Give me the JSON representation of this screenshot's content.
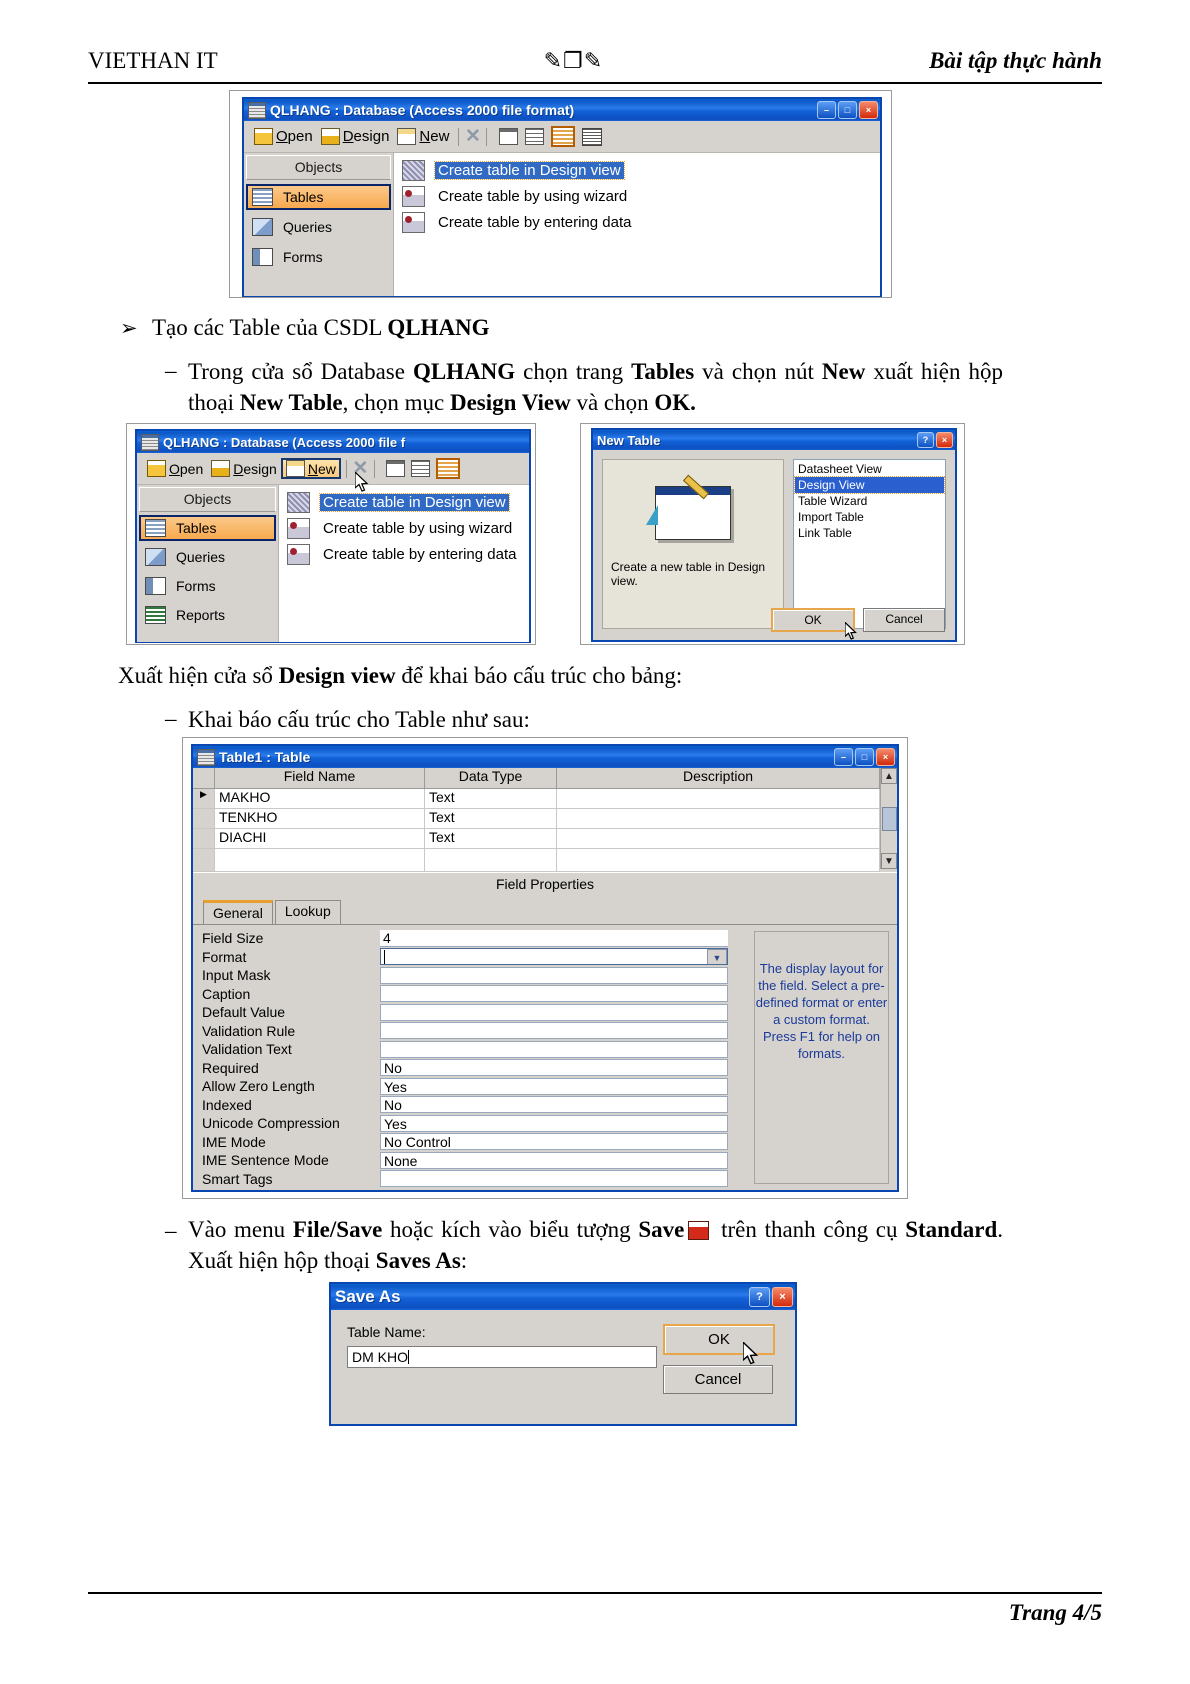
{
  "header": {
    "left": "VIETHAN IT",
    "center": "✎❐✎",
    "right": "Bài tập thực hành"
  },
  "footer": {
    "page": "Trang 4/5"
  },
  "body": {
    "bullet1_marker": "➢",
    "bullet1_a": "Tạo các Table của CSDL ",
    "bullet1_b": "QLHANG",
    "dash_marker": "–",
    "p1_1": "Trong cửa sổ Database ",
    "p1_2": "QLHANG",
    "p1_3": " chọn trang ",
    "p1_4": "Tables",
    "p1_5": " và chọn nút ",
    "p1_6": "New",
    "p1_7": " xuất hiện hộp thoại ",
    "p1_8": "New Table",
    "p1_9": ", chọn mục ",
    "p1_10": "Design View",
    "p1_11": " và chọn ",
    "p1_12": "OK.",
    "p2_1": "Xuất hiện cửa sổ ",
    "p2_2": "Design view",
    "p2_3": " để khai báo cấu trúc cho bảng:",
    "p3": "Khai báo cấu trúc cho Table như sau:",
    "p4_1": "Vào menu ",
    "p4_2": "File/Save",
    "p4_3": " hoặc kích vào biểu tượng ",
    "p4_4": "Save",
    "p4_5": " trên thanh công cụ ",
    "p4_6": "Standard",
    "p4_7": ". Xuất hiện hộp thoại ",
    "p4_8": "Saves As",
    "p4_9": ":"
  },
  "access_window": {
    "title": "QLHANG : Database (Access 2000 file format)",
    "title_short": "QLHANG : Database (Access 2000 file f",
    "buttons": {
      "minimize": "–",
      "maximize": "□",
      "close": "×"
    },
    "toolbar": {
      "open": {
        "pre": "",
        "key": "O",
        "post": "pen"
      },
      "design": {
        "pre": "",
        "key": "D",
        "post": "esign"
      },
      "new": {
        "pre": "",
        "key": "N",
        "post": "ew"
      },
      "delete": "✕",
      "large_icons": "large-icons",
      "small_icons": "small-icons",
      "details": "details",
      "list": "list"
    },
    "objects_header": "Objects",
    "objects": [
      {
        "label": "Tables",
        "selected": true
      },
      {
        "label": "Queries",
        "selected": false
      },
      {
        "label": "Forms",
        "selected": false
      },
      {
        "label": "Reports",
        "selected": false
      }
    ],
    "rows": [
      {
        "label": "Create table in Design view",
        "selected": true
      },
      {
        "label": "Create table by using wizard",
        "selected": false
      },
      {
        "label": "Create table by entering data",
        "selected": false
      }
    ]
  },
  "new_table_dialog": {
    "title": "New Table",
    "help_button": "?",
    "close_button": "×",
    "description": "Create a new table in Design view.",
    "options": [
      {
        "label": "Datasheet View",
        "selected": false
      },
      {
        "label": "Design View",
        "selected": true
      },
      {
        "label": "Table Wizard",
        "selected": false
      },
      {
        "label": "Import Table",
        "selected": false
      },
      {
        "label": "Link Table",
        "selected": false
      }
    ],
    "ok": "OK",
    "cancel": "Cancel"
  },
  "table_design": {
    "title": "Table1 : Table",
    "buttons": {
      "minimize": "–",
      "maximize": "□",
      "close": "×"
    },
    "columns": [
      "Field Name",
      "Data Type",
      "Description"
    ],
    "rows": [
      {
        "marker": "▶",
        "name": "MAKHO",
        "type": "Text",
        "desc": ""
      },
      {
        "marker": "",
        "name": "TENKHO",
        "type": "Text",
        "desc": ""
      },
      {
        "marker": "",
        "name": "DIACHI",
        "type": "Text",
        "desc": ""
      },
      {
        "marker": "",
        "name": "",
        "type": "",
        "desc": ""
      }
    ],
    "field_properties_label": "Field Properties",
    "tabs": [
      {
        "label": "General",
        "active": true
      },
      {
        "label": "Lookup",
        "active": false
      }
    ],
    "properties": [
      {
        "label": "Field Size",
        "value": "4"
      },
      {
        "label": "Format",
        "value": ""
      },
      {
        "label": "Input Mask",
        "value": ""
      },
      {
        "label": "Caption",
        "value": ""
      },
      {
        "label": "Default Value",
        "value": ""
      },
      {
        "label": "Validation Rule",
        "value": ""
      },
      {
        "label": "Validation Text",
        "value": ""
      },
      {
        "label": "Required",
        "value": "No"
      },
      {
        "label": "Allow Zero Length",
        "value": "Yes"
      },
      {
        "label": "Indexed",
        "value": "No"
      },
      {
        "label": "Unicode Compression",
        "value": "Yes"
      },
      {
        "label": "IME Mode",
        "value": "No Control"
      },
      {
        "label": "IME Sentence Mode",
        "value": "None"
      },
      {
        "label": "Smart Tags",
        "value": ""
      }
    ],
    "help_text": "The display layout for the field. Select a pre-defined format or enter a custom format. Press F1 for help on formats.",
    "scroll_up": "▲",
    "scroll_down": "▼"
  },
  "save_as_dialog": {
    "title": "Save As",
    "help_button": "?",
    "close_button": "×",
    "field_label": "Table Name:",
    "field_value": "DM KHO",
    "ok": "OK",
    "cancel": "Cancel"
  }
}
